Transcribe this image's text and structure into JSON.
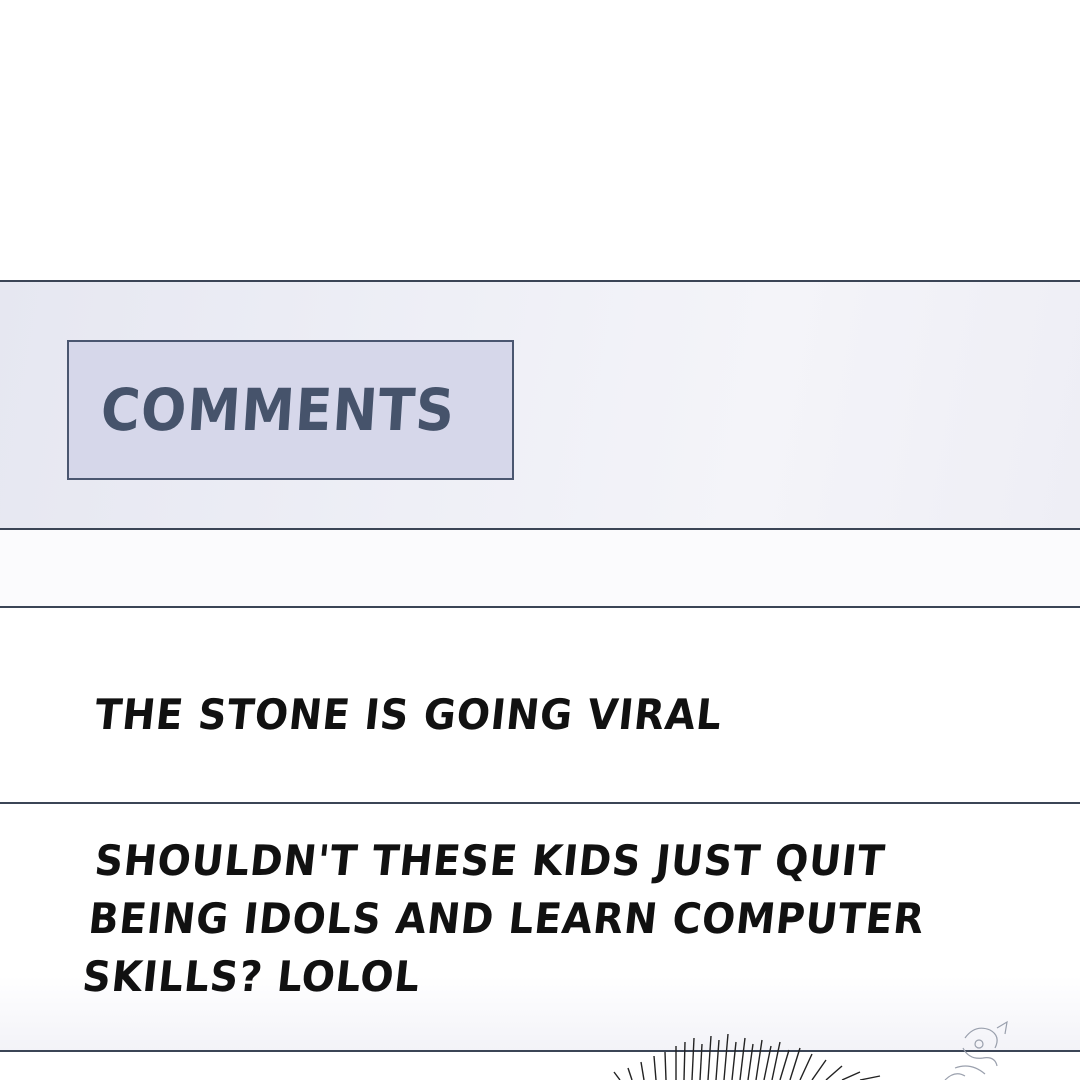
{
  "header": {
    "title": "COMMENTS"
  },
  "comments": [
    {
      "text": "THE STONE IS GOING VIRAL"
    },
    {
      "text": "SHOULDN'T THESE KIDS JUST QUIT\nBEING IDOLS AND LEARN COMPUTER\nSKILLS? LOLOL"
    }
  ],
  "colors": {
    "panel_bg": "#eeeff6",
    "tab_bg": "#d6d7ea",
    "tab_border": "#4a5670",
    "tab_text": "#46536b",
    "divider": "#3b4556",
    "comment_text": "#111111"
  },
  "icons": {
    "speed_lines": "speed-lines-icon",
    "figure": "sketch-figure-icon"
  }
}
